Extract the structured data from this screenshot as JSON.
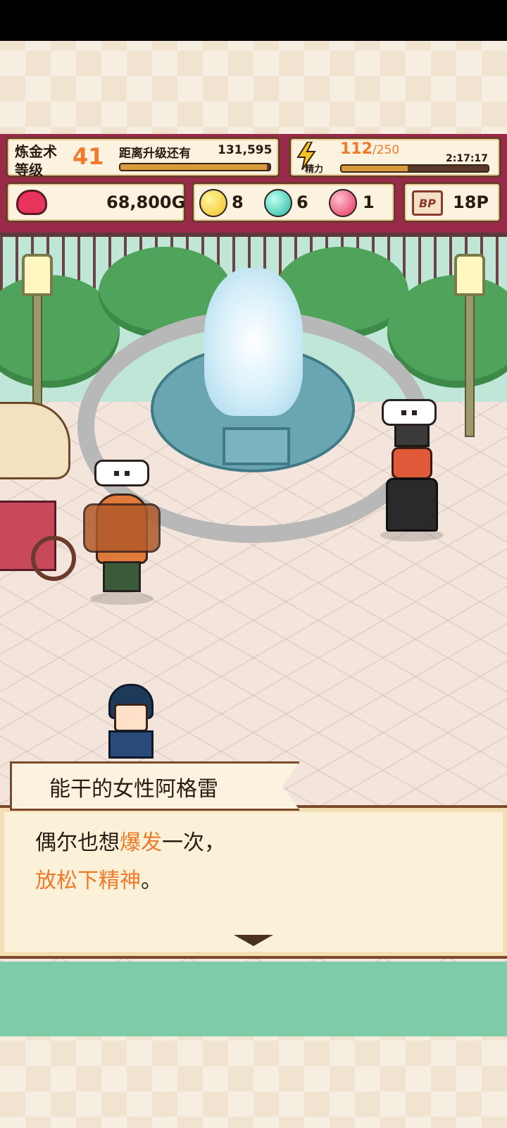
{
  "hud": {
    "alchemy_title": "炼金术",
    "level_label": "等级",
    "level_value": "41",
    "next_level_label": "距离升级还有",
    "next_level_value": "131,595",
    "exp_progress": 0.98,
    "stamina_label": "精力",
    "stamina_current": "112",
    "stamina_max": "/250",
    "stamina_progress": 0.45,
    "stamina_timer": "2:17:17",
    "gold": "68,800G",
    "gem_yellow": "8",
    "gem_teal": "6",
    "gem_pink": "1",
    "bp_icon_text": "BP",
    "bp_value": "18P"
  },
  "dialogue": {
    "speaker": "能干的女性阿格雷",
    "line1_pre": "偶尔也想",
    "line1_highlight": "爆发",
    "line1_post": "一次，",
    "line2_highlight": "放松下精神",
    "line2_post": "。"
  },
  "colors": {
    "hud_bg": "#9a2a4a",
    "highlight": "#f07a2a"
  }
}
